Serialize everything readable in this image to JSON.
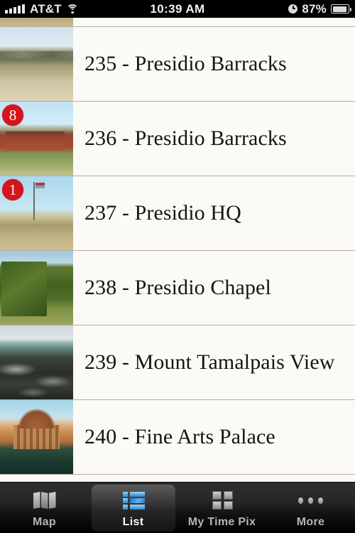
{
  "status_bar": {
    "carrier": "AT&T",
    "signal_bars": 5,
    "wifi_icon": "wifi-icon",
    "time": "10:39 AM",
    "alarm_icon": "clock-icon",
    "battery_percent": "87%",
    "battery_icon": "battery-icon"
  },
  "list": {
    "partial_row_top": {
      "thumb": "t-partial"
    },
    "rows": [
      {
        "title": "235 - Presidio Barracks",
        "badge": null,
        "thumb": "t235"
      },
      {
        "title": "236 - Presidio Barracks",
        "badge": "8",
        "thumb": "t236"
      },
      {
        "title": "237 - Presidio HQ",
        "badge": "1",
        "thumb": "t237"
      },
      {
        "title": "238 - Presidio Chapel",
        "badge": null,
        "thumb": "t238"
      },
      {
        "title": "239 - Mount Tamalpais View",
        "badge": null,
        "thumb": "t239"
      },
      {
        "title": "240 - Fine Arts Palace",
        "badge": null,
        "thumb": "t240"
      }
    ]
  },
  "tab_bar": {
    "tabs": [
      {
        "label": "Map",
        "icon": "map-icon",
        "selected": false
      },
      {
        "label": "List",
        "icon": "list-icon",
        "selected": true
      },
      {
        "label": "My Time Pix",
        "icon": "grid-icon",
        "selected": false
      },
      {
        "label": "More",
        "icon": "more-icon",
        "selected": false
      }
    ]
  },
  "colors": {
    "badge_red": "#d6141c",
    "accent_blue": "#2c7fd0",
    "list_background": "#fbfaf7",
    "separator": "#b7af9f",
    "tabbar_background": "#262626"
  }
}
